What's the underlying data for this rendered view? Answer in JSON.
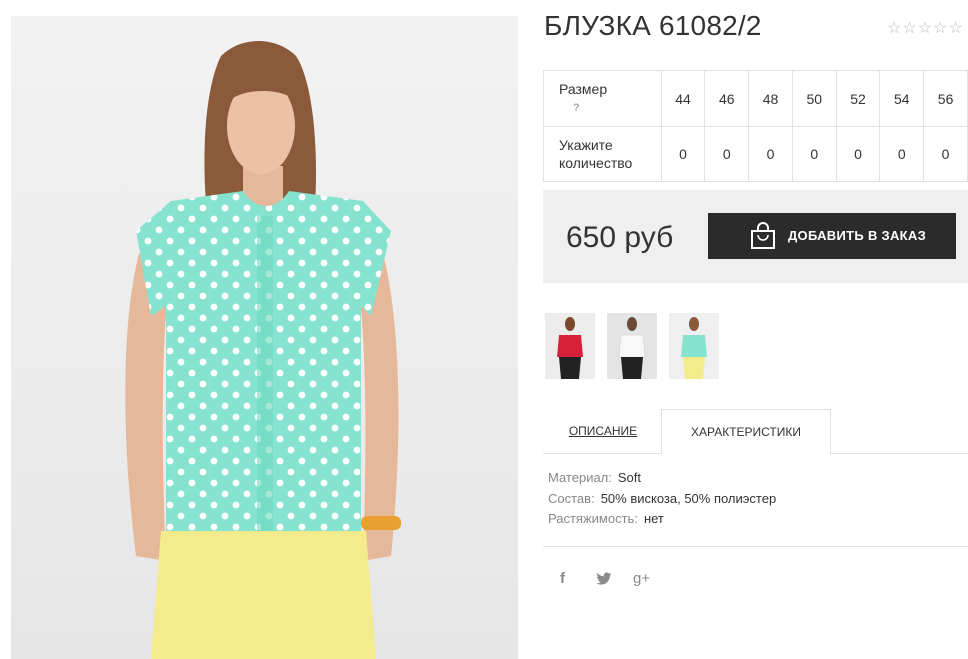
{
  "product": {
    "title": "БЛУЗКА 61082/2",
    "rating": {
      "value": 0,
      "max": 5
    }
  },
  "sizes": {
    "size_label": "Размер",
    "help_mark": "?",
    "qty_label": "Укажите количество",
    "values": [
      "44",
      "46",
      "48",
      "50",
      "52",
      "54",
      "56"
    ],
    "quantities": [
      "0",
      "0",
      "0",
      "0",
      "0",
      "0",
      "0"
    ]
  },
  "purchase": {
    "price": "650 руб",
    "add_button_label": "ДОБАВИТЬ В ЗАКАЗ"
  },
  "gallery": {
    "thumbnails": [
      {
        "icon": "blouse-red-thumbnail",
        "color": "#d7203a"
      },
      {
        "icon": "blouse-white-thumbnail",
        "color": "#f2f2f2"
      },
      {
        "icon": "blouse-mint-thumbnail",
        "color": "#86e3cf"
      }
    ]
  },
  "tabs": {
    "description": "ОПИСАНИЕ",
    "characteristics": "ХАРАКТЕРИСТИКИ",
    "active": "characteristics"
  },
  "characteristics": [
    {
      "key": "Материал:",
      "value": "Soft"
    },
    {
      "key": "Состав:",
      "value": "50% вискоза, 50% полиэстер"
    },
    {
      "key": "Растяжимость:",
      "value": "нет"
    }
  ],
  "social": {
    "facebook": "f",
    "twitter": "twitter-bird",
    "google_plus": "g+"
  },
  "colors": {
    "button_bg": "#2b2b2b",
    "price_bar_bg": "#efefef",
    "blouse": "#86e3cf",
    "pants": "#f3eb8c"
  }
}
